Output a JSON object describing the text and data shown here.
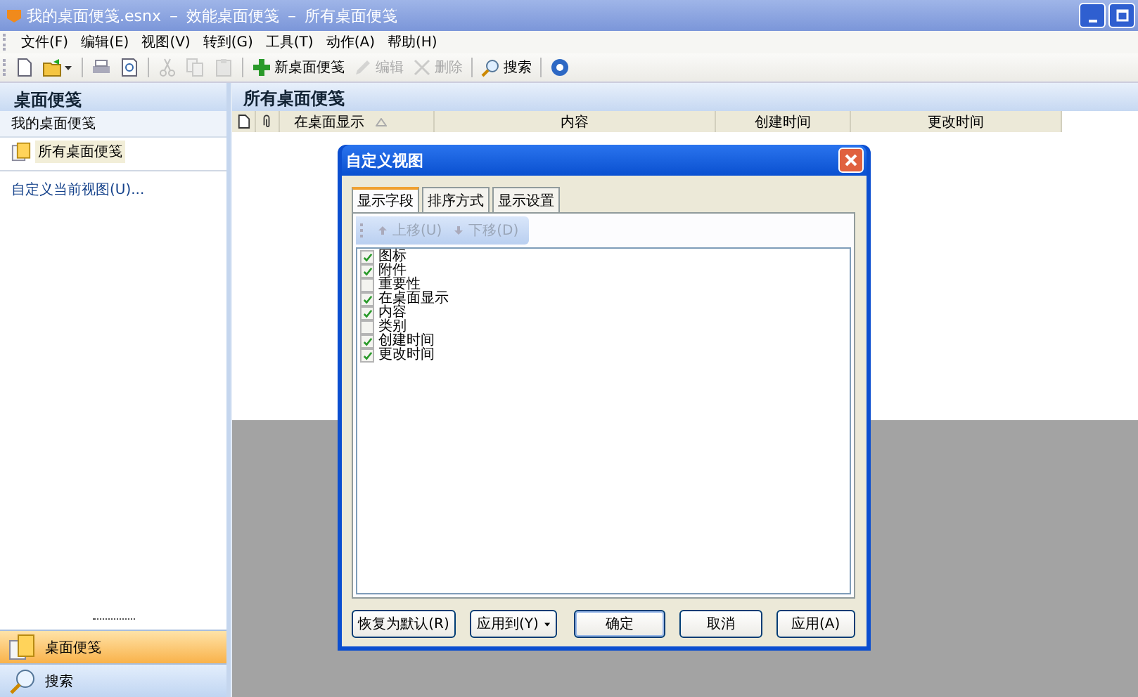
{
  "window": {
    "title": "我的桌面便笺.esnx － 效能桌面便笺 － 所有桌面便笺"
  },
  "menu": [
    "文件(F)",
    "编辑(E)",
    "视图(V)",
    "转到(G)",
    "工具(T)",
    "动作(A)",
    "帮助(H)"
  ],
  "toolbar": [
    {
      "kind": "new",
      "disabled": false
    },
    {
      "kind": "open",
      "disabled": false
    },
    {
      "kind": "print",
      "disabled": false
    },
    {
      "kind": "preview",
      "disabled": false
    },
    {
      "kind": "cut",
      "disabled": true
    },
    {
      "kind": "copy",
      "disabled": true
    },
    {
      "kind": "paste",
      "disabled": true
    },
    {
      "kind": "add",
      "label": "新桌面便笺",
      "disabled": false
    },
    {
      "kind": "edit",
      "label": "编辑",
      "disabled": true
    },
    {
      "kind": "delete",
      "label": "删除",
      "disabled": true
    },
    {
      "kind": "search",
      "label": "搜索",
      "disabled": false
    },
    {
      "kind": "help",
      "disabled": false
    }
  ],
  "sidebar": {
    "title": "桌面便笺",
    "group": "我的桌面便笺",
    "items": [
      {
        "label": "所有桌面便笺",
        "selected": true
      }
    ],
    "link": "自定义当前视图(U)...",
    "nav": [
      {
        "kind": "notes",
        "label": "桌面便笺",
        "selected": true
      },
      {
        "kind": "search",
        "label": "搜索",
        "selected": false
      }
    ]
  },
  "main": {
    "title": "所有桌面便笺",
    "columns": [
      {
        "kind": "doc"
      },
      {
        "kind": "clip"
      },
      {
        "kind": "text",
        "label": "在桌面显示",
        "sorted": true
      },
      {
        "kind": "text",
        "label": "内容",
        "sorted": false
      },
      {
        "kind": "text",
        "label": "创建时间",
        "sorted": false
      },
      {
        "kind": "text",
        "label": "更改时间",
        "sorted": false
      }
    ]
  },
  "dialog": {
    "title": "自定义视图",
    "tabs": [
      {
        "label": "显示字段",
        "selected": true
      },
      {
        "label": "排序方式",
        "selected": false
      },
      {
        "label": "显示设置",
        "selected": false
      }
    ],
    "tools": [
      {
        "kind": "up",
        "label": "上移(U)",
        "disabled": true
      },
      {
        "kind": "down",
        "label": "下移(D)",
        "disabled": true
      }
    ],
    "fields": [
      {
        "label": "图标",
        "checked": true
      },
      {
        "label": "附件",
        "checked": true
      },
      {
        "label": "重要性",
        "checked": false
      },
      {
        "label": "在桌面显示",
        "checked": true
      },
      {
        "label": "内容",
        "checked": true
      },
      {
        "label": "类别",
        "checked": false
      },
      {
        "label": "创建时间",
        "checked": true
      },
      {
        "label": "更改时间",
        "checked": true
      }
    ],
    "buttons": [
      {
        "label": "恢复为默认(R)",
        "kind": "plain",
        "default": false
      },
      {
        "label": "应用到(Y)",
        "kind": "menu",
        "default": false
      },
      {
        "label": "确定",
        "kind": "plain",
        "default": true
      },
      {
        "label": "取消",
        "kind": "plain",
        "default": false
      },
      {
        "label": "应用(A)",
        "kind": "plain",
        "default": false
      }
    ]
  }
}
